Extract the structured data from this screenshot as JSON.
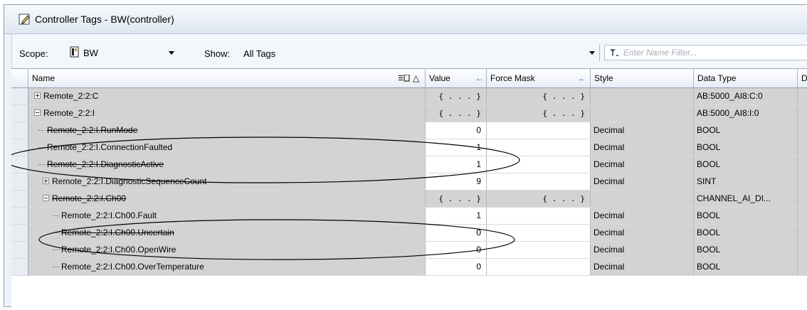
{
  "window": {
    "title": "Controller Tags - BW(controller)"
  },
  "toolbar": {
    "scope_label": "Scope:",
    "scope_value": "BW",
    "show_label": "Show:",
    "show_value": "All Tags",
    "filter_placeholder": "Enter Name Filter..."
  },
  "grid": {
    "columns": {
      "name": "Name",
      "sort_indicator": "△",
      "value": "Value",
      "force_mask": "Force Mask",
      "style": "Style",
      "data_type": "Data Type",
      "extra": "D"
    },
    "rows": [
      {
        "name": "Remote_2:2:C",
        "value": "{...}",
        "force": "{...}",
        "style": "",
        "type": "AB:5000_AI8:C:0"
      },
      {
        "name": "Remote_2:2:I",
        "value": "{...}",
        "force": "{...}",
        "style": "",
        "type": "AB:5000_AI8:I:0"
      },
      {
        "name": "Remote_2:2:I.RunMode",
        "value": "0",
        "force": "",
        "style": "Decimal",
        "type": "BOOL"
      },
      {
        "name": "Remote_2:2:I.ConnectionFaulted",
        "value": "1",
        "force": "",
        "style": "Decimal",
        "type": "BOOL"
      },
      {
        "name": "Remote_2:2:I.DiagnosticActive",
        "value": "1",
        "force": "",
        "style": "Decimal",
        "type": "BOOL"
      },
      {
        "name": "Remote_2:2:I.DiagnosticSequenceCount",
        "value": "9",
        "force": "",
        "style": "Decimal",
        "type": "SINT"
      },
      {
        "name": "Remote_2:2:I.Ch00",
        "value": "{...}",
        "force": "{...}",
        "style": "",
        "type": "CHANNEL_AI_DI..."
      },
      {
        "name": "Remote_2:2:I.Ch00.Fault",
        "value": "1",
        "force": "",
        "style": "Decimal",
        "type": "BOOL"
      },
      {
        "name": "Remote_2:2:I.Ch00.Uncertain",
        "value": "0",
        "force": "",
        "style": "Decimal",
        "type": "BOOL"
      },
      {
        "name": "Remote_2:2:I.Ch00.OpenWire",
        "value": "0",
        "force": "",
        "style": "Decimal",
        "type": "BOOL"
      },
      {
        "name": "Remote_2:2:I.Ch00.OverTemperature",
        "value": "0",
        "force": "",
        "style": "Decimal",
        "type": "BOOL"
      }
    ]
  }
}
